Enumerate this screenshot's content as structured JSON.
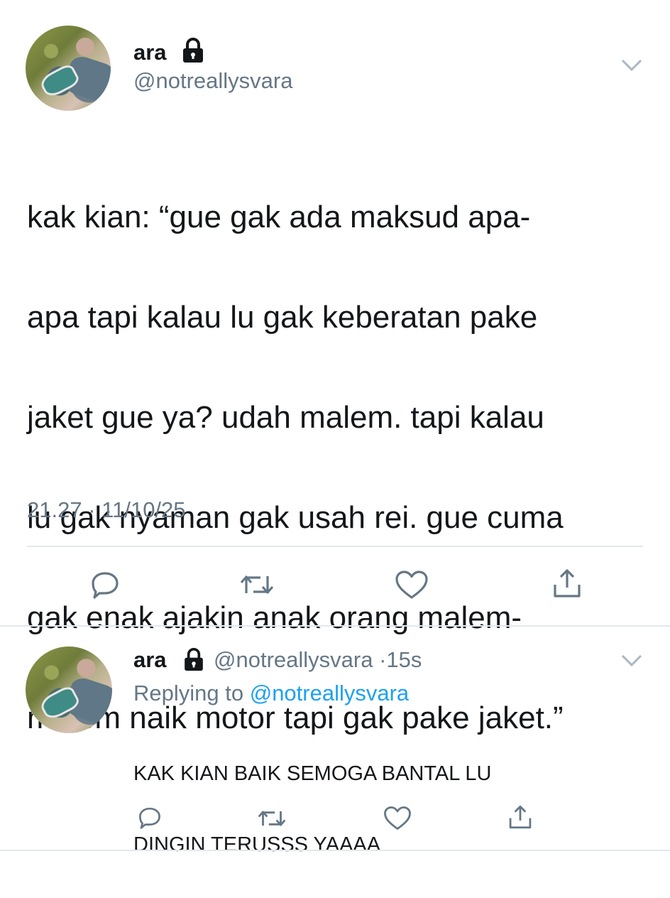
{
  "main_tweet": {
    "display_name": "ara",
    "handle": "@notreallysvara",
    "lock_icon": "lock-icon",
    "text_lines": [
      "kak kian: “gue gak ada maksud apa-",
      "apa tapi kalau lu gak keberatan pake",
      "jaket gue ya? udah malem. tapi kalau",
      "lu gak nyaman gak usah rei. gue cuma",
      "gak enak ajakin anak orang malem-",
      "malem naik motor tapi gak pake jaket.”"
    ],
    "time": "21.27",
    "separator": "·",
    "date": "11/10/25",
    "actions": [
      "reply-icon",
      "retweet-icon",
      "like-icon",
      "share-icon"
    ]
  },
  "reply_tweet": {
    "display_name": "ara",
    "handle": "@notreallysvara",
    "dot": "·",
    "age": "15s",
    "replying_prefix": "Replying to",
    "replying_handle": "@notreallysvara",
    "text_lines": [
      "KAK KIAN BAIK SEMOGA BANTAL LU",
      "DINGIN TERUSSS YAAAA"
    ],
    "actions": [
      "reply-icon",
      "retweet-icon",
      "like-icon",
      "share-icon"
    ]
  },
  "colors": {
    "text": "#14171a",
    "secondary": "#657786",
    "link": "#1da1f2",
    "divider": "#e1e8ed",
    "icon": "#657786"
  }
}
